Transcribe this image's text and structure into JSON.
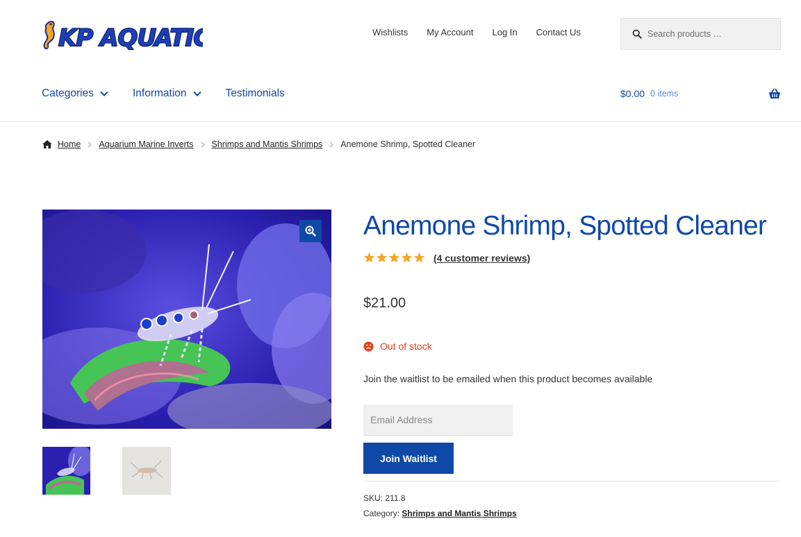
{
  "brand": {
    "logo_text": "KP AQUATICS",
    "primary_color": "#0f49a8",
    "alert_color": "#e2401c",
    "star_color": "#f6a623"
  },
  "top_nav": [
    "Wishlists",
    "My Account",
    "Log In",
    "Contact Us"
  ],
  "search": {
    "placeholder": "Search products …",
    "icon": "search-icon"
  },
  "main_nav": [
    {
      "label": "Categories",
      "has_dropdown": true
    },
    {
      "label": "Information",
      "has_dropdown": true
    },
    {
      "label": "Testimonials",
      "has_dropdown": false
    }
  ],
  "cart": {
    "total": "$0.00",
    "count": "0 items",
    "icon": "basket-icon"
  },
  "breadcrumb": {
    "home": "Home",
    "items": [
      "Aquarium Marine Inverts",
      "Shrimps and Mantis Shrimps"
    ],
    "current": "Anemone Shrimp, Spotted Cleaner"
  },
  "product": {
    "title": "Anemone Shrimp, Spotted Cleaner",
    "rating_stars": 5,
    "reviews": "(4 customer reviews)",
    "price": "$21.00",
    "stock": "Out of stock",
    "waitlist_text": "Join the waitlist to be emailed when this product becomes available",
    "email_placeholder": "Email Address",
    "join_button": "Join Waitlist",
    "sku_label": "SKU:",
    "sku": "211.8",
    "category_label": "Category:",
    "category": "Shrimps and Mantis Shrimps"
  }
}
